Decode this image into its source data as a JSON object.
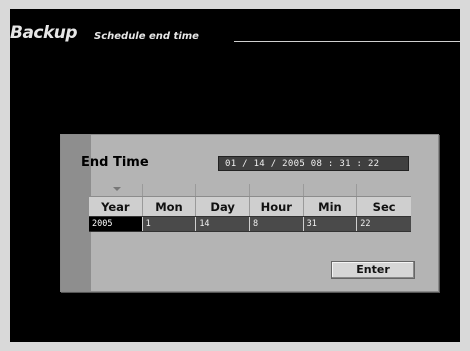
{
  "header": {
    "title": "Backup",
    "subtitle": "Schedule end time"
  },
  "dialog": {
    "title": "End Time",
    "display": "01 / 14 / 2005  08 : 31 : 22",
    "columns": [
      {
        "label": "Year",
        "value": "2005"
      },
      {
        "label": "Mon",
        "value": "1"
      },
      {
        "label": "Day",
        "value": "14"
      },
      {
        "label": "Hour",
        "value": "8"
      },
      {
        "label": "Min",
        "value": "31"
      },
      {
        "label": "Sec",
        "value": "22"
      }
    ],
    "enter_label": "Enter",
    "selected_column": "Year"
  },
  "colors": {
    "background": "#000000",
    "panel": "#b4b4b4",
    "value_field": "#4a4a4a"
  }
}
